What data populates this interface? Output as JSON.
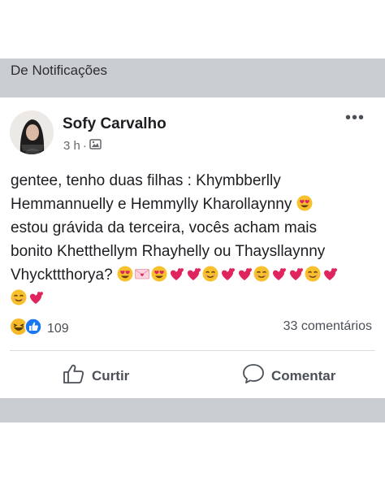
{
  "header": {
    "title": "De Notificações"
  },
  "post": {
    "author": "Sofy Carvalho",
    "time": "3 h",
    "separator": "·",
    "lines": [
      "gentee, tenho duas filhas : Khymbberlly",
      "Hemmannuelly e Hemmylly Kharollaynny",
      "estou grávida da terceira, vocês acham mais",
      "bonito Khetthellym Rhayhelly ou Thaysllaynny",
      "Vhyckttthorya?"
    ],
    "emoji": {
      "after_line_2": [
        "heart-eyes"
      ],
      "after_line_5": [
        "heart-eyes",
        "love-letter",
        "heart-eyes",
        "heart",
        "heart",
        "smiling",
        "heart",
        "heart",
        "smiling",
        "heart",
        "heart",
        "smiling",
        "heart"
      ],
      "line_6": [
        "smiling",
        "heart"
      ]
    }
  },
  "stats": {
    "reaction_icons": [
      "haha-icon",
      "like-icon"
    ],
    "reaction_count": "109",
    "comments": "33 comentários"
  },
  "actions": {
    "like_label": "Curtir",
    "comment_label": "Comentar"
  },
  "colors": {
    "header_bg": "#c9ccd1",
    "text": "#1c1e21",
    "secondary": "#65676b",
    "like_blue": "#1877f2"
  }
}
